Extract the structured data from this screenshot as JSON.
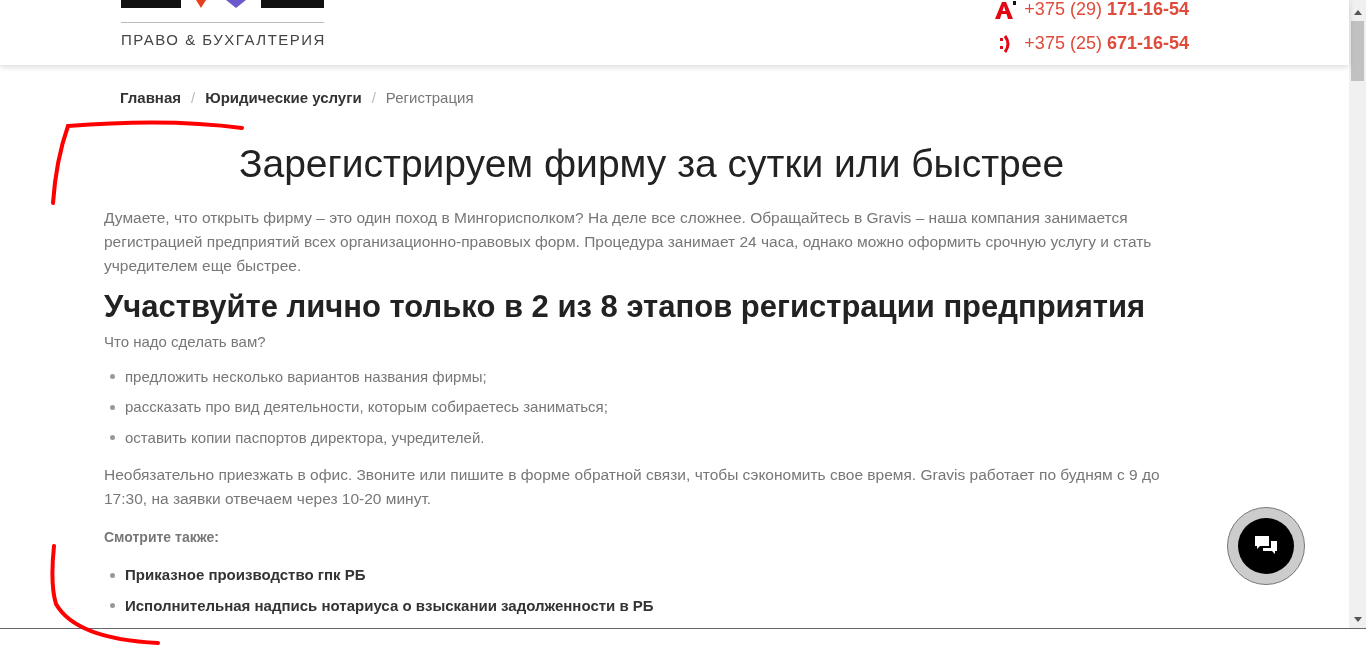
{
  "header": {
    "tagline": "ПРАВО & БУХГАЛТЕРИЯ",
    "phones": [
      {
        "kind": "a1",
        "number": "+375 (29) **171-16-54**"
      },
      {
        "kind": "mts",
        "number": "+375 (25) **671-16-54**"
      }
    ]
  },
  "breadcrumbs": [
    {
      "label": "Главная",
      "current": false
    },
    {
      "separator": "/",
      "label": "Юридические услуги",
      "current": false
    },
    {
      "separator": "/",
      "label": "Регистрация",
      "current": true
    }
  ],
  "title": "Зарегистрируем фирму за сутки или быстрее",
  "intro": "Думаете, что открыть фирму – это один поход в Мингорисполком? На деле все сложнее. Обращайтесь в Gravis – наша компания занимается регистрацией предприятий всех организационно-правовых форм. Процедура занимает 24 часа, однако можно оформить срочную услугу и стать учредителем еще быстрее.",
  "section": {
    "heading": "Участвуйте лично только в 2 из 8 этапов регистрации предприятия",
    "question": "Что надо сделать вам?",
    "steps": [
      "предложить несколько вариантов названия фирмы;",
      "рассказать про вид деятельности, которым собираетесь заниматься;",
      "оставить копии паспортов директора, учредителей."
    ],
    "note": "Необязательно приезжать в офис. Звоните или пишите в форме обратной связи, чтобы сэкономить свое время. Gravis работает по будням с 9 до 17:30, на заявки отвечаем через 10-20 минут."
  },
  "see_also": {
    "title": "Смотрите также:",
    "links": [
      "Приказное производство гпк РБ",
      "Исполнительная надпись нотариуса о взыскании задолженности в РБ"
    ]
  }
}
